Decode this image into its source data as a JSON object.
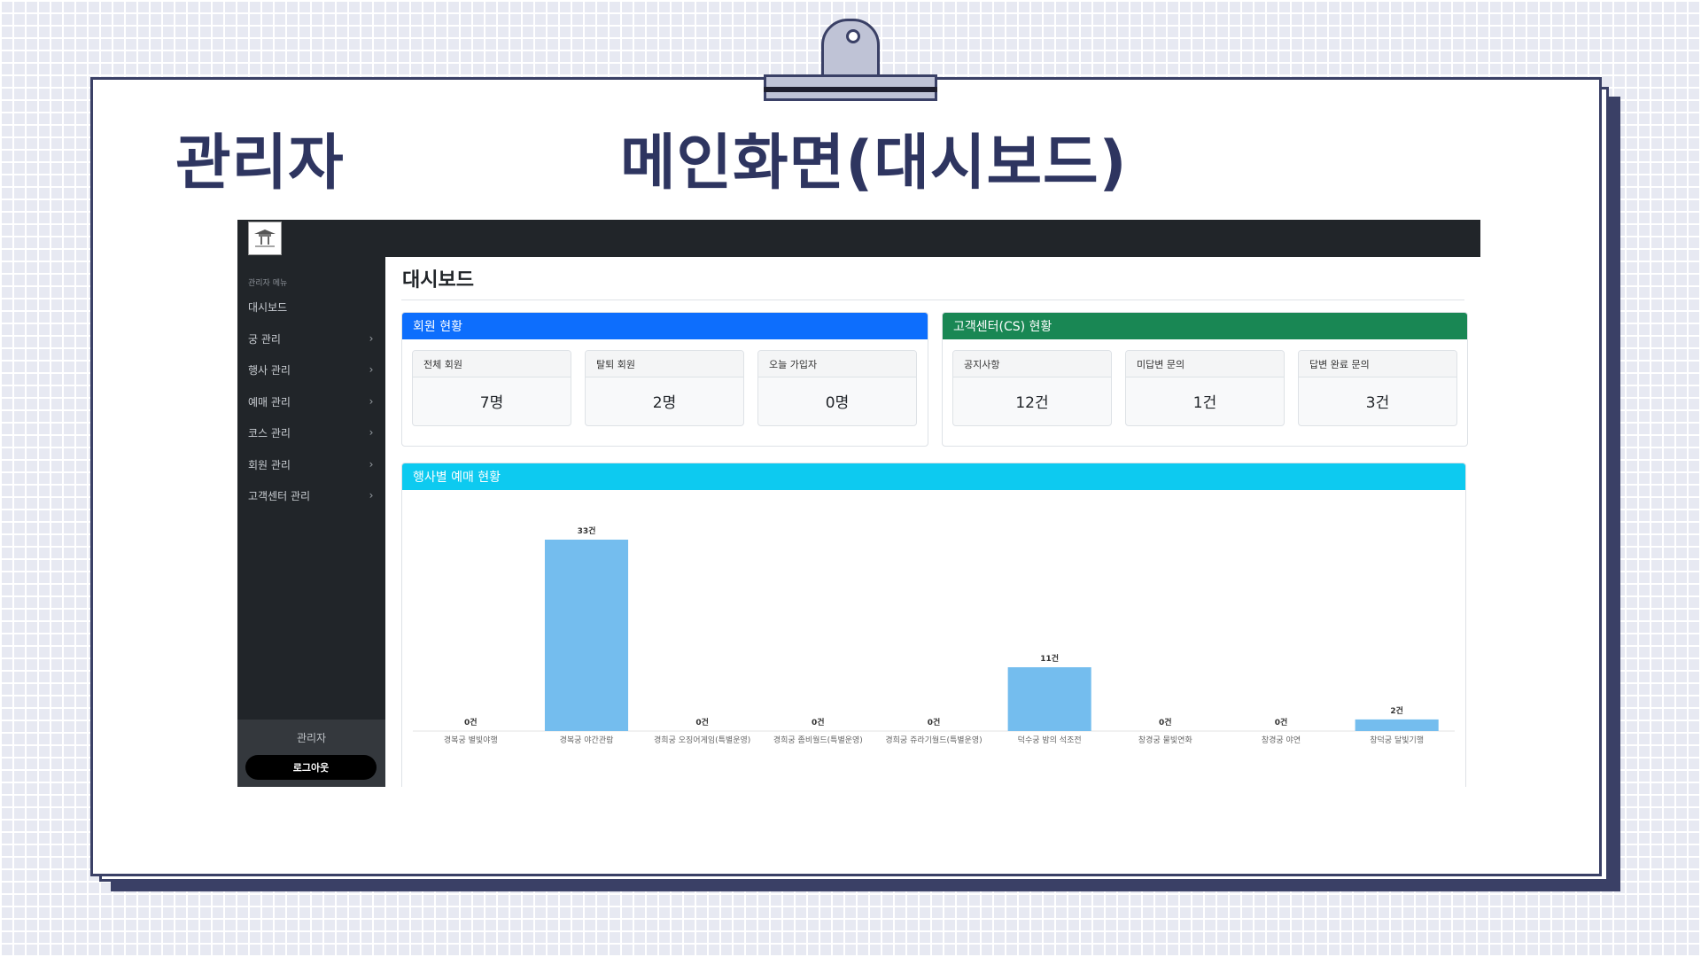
{
  "slide": {
    "title_left": "관리자",
    "title_main": "메인화면(대시보드)"
  },
  "app": {
    "sidebar": {
      "section_label": "관리자 메뉴",
      "items": [
        {
          "label": "대시보드",
          "has_chevron": false
        },
        {
          "label": "궁 관리",
          "has_chevron": true
        },
        {
          "label": "행사 관리",
          "has_chevron": true
        },
        {
          "label": "예매 관리",
          "has_chevron": true
        },
        {
          "label": "코스 관리",
          "has_chevron": true
        },
        {
          "label": "회원 관리",
          "has_chevron": true
        },
        {
          "label": "고객센터 관리",
          "has_chevron": true
        }
      ],
      "user": "관리자",
      "logout_label": "로그아웃"
    },
    "page_title": "대시보드",
    "member_card": {
      "title": "회원 현황",
      "color": "#0d6efd",
      "stats": [
        {
          "label": "전체 회원",
          "value": "7명"
        },
        {
          "label": "탈퇴 회원",
          "value": "2명"
        },
        {
          "label": "오늘 가입자",
          "value": "0명"
        }
      ]
    },
    "cs_card": {
      "title": "고객센터(CS) 현황",
      "color": "#198754",
      "stats": [
        {
          "label": "공지사항",
          "value": "12건"
        },
        {
          "label": "미답변 문의",
          "value": "1건"
        },
        {
          "label": "답변 완료 문의",
          "value": "3건"
        }
      ]
    },
    "chart_card": {
      "title": "행사별 예매 현황",
      "color": "#0dcaf0"
    }
  },
  "chart_data": {
    "type": "bar",
    "categories": [
      "경복궁 별빛야행",
      "경복궁 야간관람",
      "경희궁 오징어게임(특별운영)",
      "경희궁 좀비월드(특별운영)",
      "경희궁 쥬라기월드(특별운영)",
      "덕수궁 밤의 석조전",
      "창경궁 물빛연화",
      "창경궁 야연",
      "창덕궁 달빛기행"
    ],
    "values": [
      0,
      33,
      0,
      0,
      0,
      11,
      0,
      0,
      2
    ],
    "data_labels": [
      "0건",
      "33건",
      "0건",
      "0건",
      "0건",
      "11건",
      "0건",
      "0건",
      "2건"
    ],
    "bar_color": "#74bdee",
    "ylim": [
      0,
      33
    ],
    "grid": false,
    "legend": "none"
  }
}
